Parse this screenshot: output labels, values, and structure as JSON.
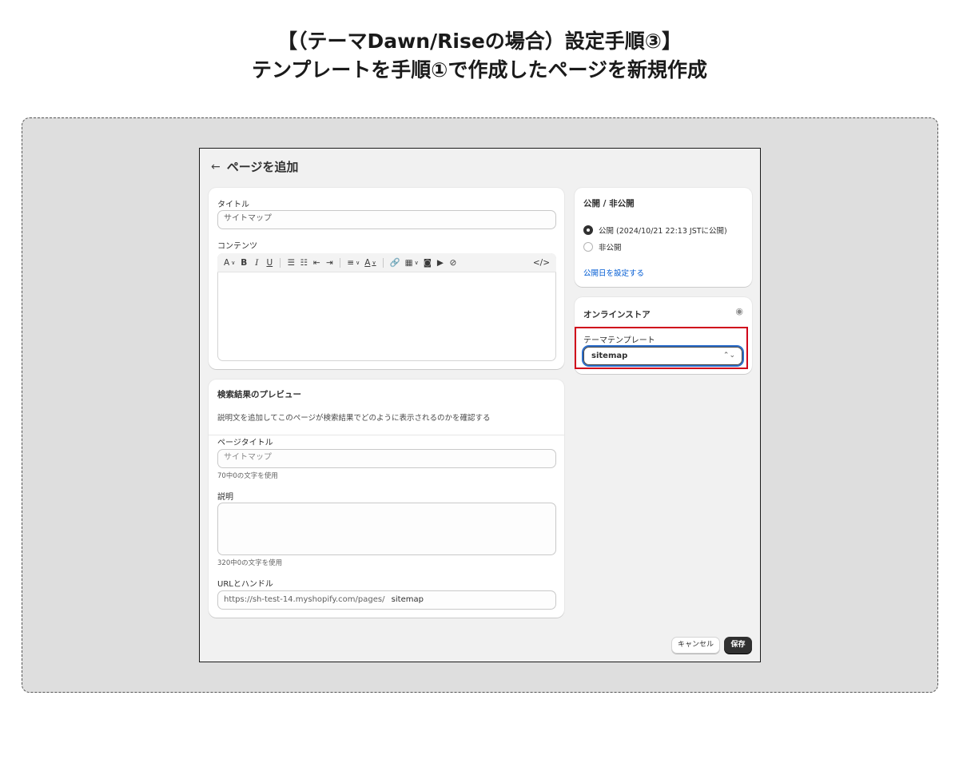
{
  "heading": {
    "line1": "【（テーマDawn/Riseの場合）設定手順③】",
    "line2": "テンプレートを手順①で作成したページを新規作成"
  },
  "page": {
    "back_icon": "arrow-left-icon",
    "title": "ページを追加"
  },
  "main_card": {
    "title_label": "タイトル",
    "title_value": "サイトマップ",
    "content_label": "コンテンツ",
    "toolbar": [
      "A",
      "B",
      "I",
      "U"
    ]
  },
  "seo_card": {
    "title": "検索結果のプレビュー",
    "description": "説明文を追加してこのページが検索結果でどのように表示されるのかを確認する",
    "page_title_label": "ページタイトル",
    "page_title_placeholder": "サイトマップ",
    "page_title_hint": "70中0の文字を使用",
    "description_label": "説明",
    "description_hint": "320中0の文字を使用",
    "url_label": "URLとハンドル",
    "url_prefix": "https://sh-test-14.myshopify.com/pages/",
    "url_handle": "sitemap"
  },
  "visibility_card": {
    "title": "公開 / 非公開",
    "option_visible": "公開 (2024/10/21 22:13 JSTに公開)",
    "option_hidden": "非公開",
    "set_date_link": "公開日を設定する"
  },
  "store_card": {
    "title": "オンラインストア",
    "template_label": "テーマテンプレート",
    "template_value": "sitemap"
  },
  "footer": {
    "cancel_label": "キャンセル",
    "save_label": "保存"
  },
  "colors": {
    "highlight": "#d0021b",
    "link": "#005bd3",
    "primary_button": "#303030"
  }
}
